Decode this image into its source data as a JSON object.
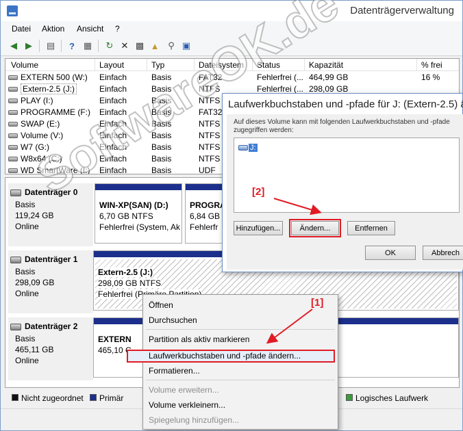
{
  "window": {
    "title": "Datenträgerverwaltung"
  },
  "menu": [
    "Datei",
    "Aktion",
    "Ansicht",
    "?"
  ],
  "volume_list": {
    "columns": [
      "Volume",
      "Layout",
      "Typ",
      "Dateisystem",
      "Status",
      "Kapazität",
      "% frei"
    ],
    "rows": [
      [
        "EXTERN 500 (W:)",
        "Einfach",
        "Basis",
        "FAT32",
        "Fehlerfrei (...",
        "464,99 GB",
        "16 %"
      ],
      [
        "Extern-2.5 (J:)",
        "Einfach",
        "Basis",
        "NTFS",
        "Fehlerfrei (...",
        "298,09 GB",
        ""
      ],
      [
        "PLAY (I:)",
        "Einfach",
        "Basis",
        "NTFS",
        "",
        "",
        ""
      ],
      [
        "PROGRAMME (F:)",
        "Einfach",
        "Basis",
        "FAT32",
        "",
        "",
        ""
      ],
      [
        "SWAP (E:)",
        "Einfach",
        "Basis",
        "NTFS",
        "",
        "",
        ""
      ],
      [
        "Volume (V:)",
        "Einfach",
        "Basis",
        "NTFS",
        "",
        "",
        ""
      ],
      [
        "W7 (G:)",
        "Einfach",
        "Basis",
        "NTFS",
        "",
        "",
        ""
      ],
      [
        "W8x64 (C:)",
        "Einfach",
        "Basis",
        "NTFS",
        "",
        "",
        ""
      ],
      [
        "WD SmartWare (I:)",
        "Einfach",
        "Basis",
        "UDF",
        "",
        "",
        ""
      ]
    ]
  },
  "disks": [
    {
      "name": "Datenträger 0",
      "type": "Basis",
      "size": "119,24 GB",
      "state": "Online",
      "parts": [
        {
          "name": "WIN-XP(SAN) (D:)",
          "size": "6,70 GB NTFS",
          "status": "Fehlerfrei (System, Ak"
        },
        {
          "name": "PROGRA",
          "size": "6,84 GB F",
          "status": "Fehlerfr"
        }
      ]
    },
    {
      "name": "Datenträger 1",
      "type": "Basis",
      "size": "298,09 GB",
      "state": "Online",
      "parts": [
        {
          "name": "Extern-2.5  (J:)",
          "size": "298,09 GB NTFS",
          "status": "Fehlerfrei (Primäre Partition)"
        }
      ]
    },
    {
      "name": "Datenträger 2",
      "type": "Basis",
      "size": "465,11 GB",
      "state": "Online",
      "parts": [
        {
          "name": "EXTERN",
          "size": "465,10 G",
          "status": ""
        }
      ]
    }
  ],
  "legend": [
    "Nicht zugeordnet",
    "Primär",
    "Logisches Laufwerk"
  ],
  "dialog": {
    "title": "Laufwerkbuchstaben und -pfade für J: (Extern-2.5) ä...",
    "text": "Auf dieses Volume kann mit folgenden Laufwerkbuchstaben und -pfade zugegriffen werden:",
    "item": "J:",
    "buttons": {
      "add": "Hinzufügen...",
      "change": "Ändern...",
      "remove": "Entfernen",
      "ok": "OK",
      "cancel": "Abbrech"
    }
  },
  "context_menu": {
    "items": [
      "Öffnen",
      "Durchsuchen",
      "Partition als aktiv markieren",
      "Laufwerkbuchstaben und -pfade ändern...",
      "Formatieren...",
      "Volume erweitern...",
      "Volume verkleinern...",
      "Spiegelung hinzufügen..."
    ]
  },
  "annotations": {
    "step1": "[1]",
    "step2": "[2]"
  },
  "watermark": "SoftwareOK.de",
  "colors": {
    "primary_partition": "#1c2f8c",
    "unallocated": "#111111",
    "highlight": "#e01b24"
  }
}
